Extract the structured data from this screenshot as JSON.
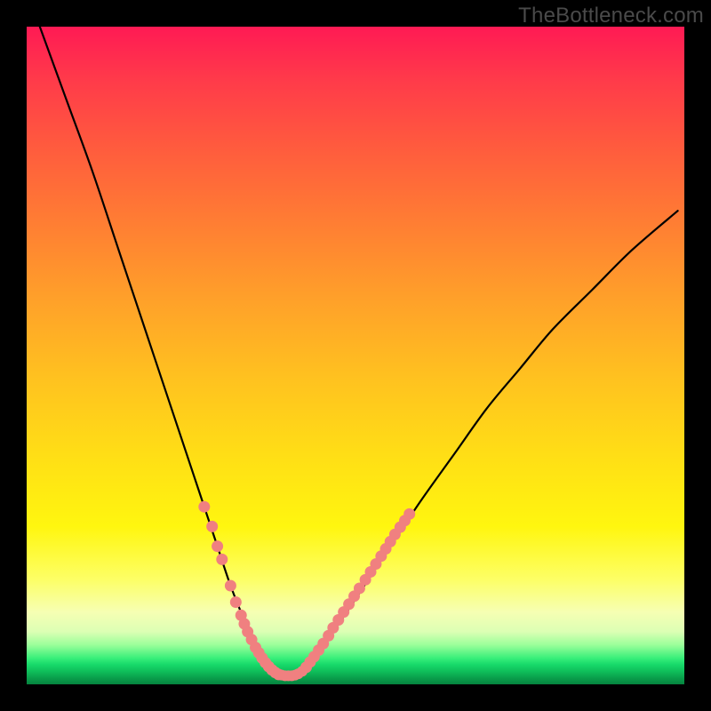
{
  "watermark": "TheBottleneck.com",
  "chart_data": {
    "type": "line",
    "title": "",
    "xlabel": "",
    "ylabel": "",
    "xlim": [
      0,
      100
    ],
    "ylim": [
      0,
      100
    ],
    "grid": false,
    "legend": false,
    "series": [
      {
        "name": "bottleneck-curve",
        "type": "line",
        "color": "#000000",
        "x": [
          2,
          6,
          10,
          14,
          18,
          22,
          25,
          27,
          29,
          31,
          33,
          34.5,
          36,
          37,
          38,
          39.5,
          41,
          43,
          45,
          48,
          52,
          56,
          60,
          65,
          70,
          75,
          80,
          86,
          92,
          99
        ],
        "y": [
          100,
          89,
          78,
          66,
          54,
          42,
          33,
          27,
          21,
          15,
          10,
          7,
          4.5,
          3,
          2,
          1.4,
          1.4,
          3,
          6,
          10,
          16,
          22,
          28,
          35,
          42,
          48,
          54,
          60,
          66,
          72
        ]
      },
      {
        "name": "left-branch-markers",
        "type": "scatter",
        "color": "#f08080",
        "marker": "circle",
        "x": [
          27,
          28.2,
          29,
          29.7,
          31,
          31.8,
          32.6,
          33.1,
          33.6,
          34.2,
          34.8,
          35.3,
          35.8,
          36.3,
          36.8,
          37.3,
          37.8,
          38.3
        ],
        "y": [
          27,
          24,
          21,
          19,
          15,
          12.5,
          10.5,
          9.2,
          8,
          6.8,
          5.6,
          4.8,
          4,
          3.3,
          2.7,
          2.2,
          1.8,
          1.5
        ]
      },
      {
        "name": "bottom-markers",
        "type": "scatter",
        "color": "#f08080",
        "marker": "circle",
        "x": [
          38.8,
          39.3,
          39.8,
          40.3,
          40.8,
          41.3,
          41.9
        ],
        "y": [
          1.4,
          1.3,
          1.3,
          1.3,
          1.4,
          1.6,
          2.0
        ]
      },
      {
        "name": "right-branch-markers",
        "type": "scatter",
        "color": "#f08080",
        "marker": "circle",
        "x": [
          42.5,
          43.1,
          43.7,
          44.4,
          45.1,
          45.9,
          46.6,
          47.4,
          48.2,
          49,
          49.8,
          50.6,
          51.5,
          52.3,
          53.1,
          53.9,
          54.6,
          55.3,
          56,
          56.8,
          57.5,
          58.2
        ],
        "y": [
          2.6,
          3.4,
          4.2,
          5.2,
          6.2,
          7.4,
          8.6,
          9.8,
          11,
          12.2,
          13.4,
          14.6,
          15.9,
          17.1,
          18.3,
          19.5,
          20.6,
          21.7,
          22.8,
          23.9,
          24.9,
          25.9
        ]
      }
    ],
    "annotations": []
  }
}
